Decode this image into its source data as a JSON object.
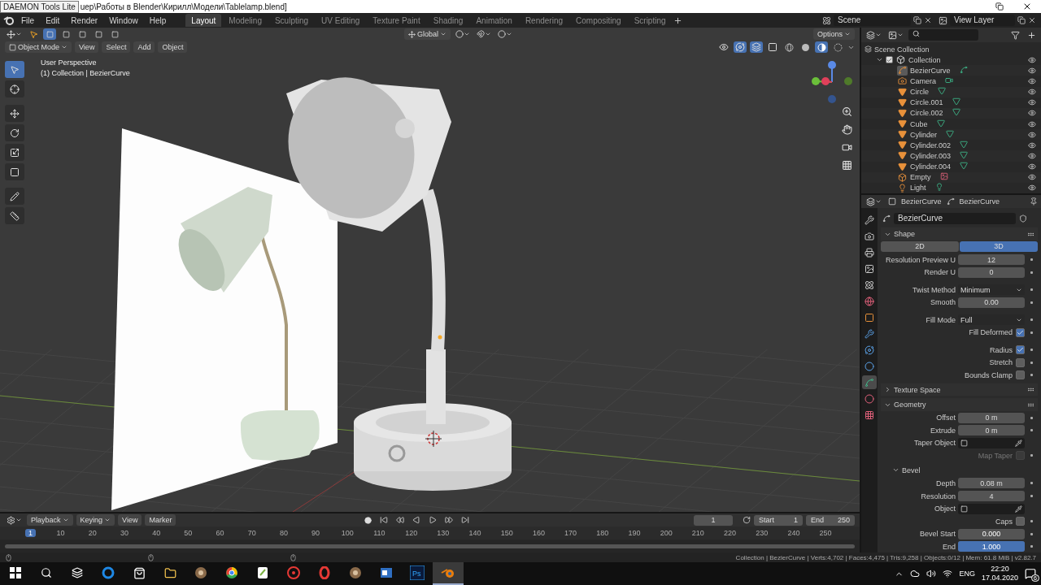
{
  "title_bar": {
    "tooltip": "DAEMON Tools Lite",
    "path": "uep\\Работы в Blender\\Кирилл\\Модели\\Tablelamp.blend]"
  },
  "menu": [
    "File",
    "Edit",
    "Render",
    "Window",
    "Help"
  ],
  "workspaces": [
    {
      "label": "Layout",
      "selected": true
    },
    {
      "label": "Modeling",
      "selected": false
    },
    {
      "label": "Sculpting",
      "selected": false
    },
    {
      "label": "UV Editing",
      "selected": false
    },
    {
      "label": "Texture Paint",
      "selected": false
    },
    {
      "label": "Shading",
      "selected": false
    },
    {
      "label": "Animation",
      "selected": false
    },
    {
      "label": "Rendering",
      "selected": false
    },
    {
      "label": "Compositing",
      "selected": false
    },
    {
      "label": "Scripting",
      "selected": false
    }
  ],
  "scene": "Scene",
  "view_layer": "View Layer",
  "viewport": {
    "select_modes": [
      {
        "selected": true
      },
      {
        "selected": false
      },
      {
        "selected": false
      },
      {
        "selected": false
      },
      {
        "selected": false
      }
    ],
    "orientation": "Global",
    "options": "Options",
    "mode": "Object Mode",
    "menus": [
      "View",
      "Select",
      "Add",
      "Object"
    ],
    "toggles": [
      {
        "kind": "visibility",
        "on": false
      },
      {
        "kind": "gizmo",
        "on": true
      },
      {
        "kind": "overlay",
        "on": true
      },
      {
        "kind": "xray",
        "on": false
      }
    ],
    "shading": [
      {
        "kind": "wireframe",
        "selected": false
      },
      {
        "kind": "solid",
        "selected": false
      },
      {
        "kind": "material",
        "selected": true
      },
      {
        "kind": "rendered",
        "selected": false
      }
    ],
    "overlay_title": "User Perspective",
    "overlay_subtitle": "(1) Collection | BezierCurve",
    "tools": [
      {
        "kind": "select",
        "selected": true
      },
      {
        "kind": "cursor",
        "selected": false
      },
      {
        "kind": "move",
        "selected": false
      },
      {
        "kind": "rotate",
        "selected": false
      },
      {
        "kind": "scale",
        "selected": false
      },
      {
        "kind": "transform",
        "selected": false
      },
      {
        "kind": "annotate",
        "selected": false
      },
      {
        "kind": "measure",
        "selected": false
      }
    ]
  },
  "outliner": {
    "root": "Scene Collection",
    "tree": [
      {
        "name": "Collection",
        "kind": "collection",
        "checked": true,
        "expanded": true,
        "children": [
          {
            "name": "BezierCurve",
            "kind": "curve",
            "selected": true
          },
          {
            "name": "Camera",
            "kind": "camera",
            "selected": false
          },
          {
            "name": "Circle",
            "kind": "mesh",
            "selected": false
          },
          {
            "name": "Circle.001",
            "kind": "mesh",
            "selected": false
          },
          {
            "name": "Circle.002",
            "kind": "mesh",
            "selected": false
          },
          {
            "name": "Cube",
            "kind": "mesh",
            "selected": false
          },
          {
            "name": "Cylinder",
            "kind": "mesh",
            "selected": false
          },
          {
            "name": "Cylinder.002",
            "kind": "mesh",
            "selected": false
          },
          {
            "name": "Cylinder.003",
            "kind": "mesh",
            "selected": false
          },
          {
            "name": "Cylinder.004",
            "kind": "mesh",
            "selected": false
          },
          {
            "name": "Empty",
            "kind": "empty",
            "selected": false
          },
          {
            "name": "Light",
            "kind": "light",
            "selected": false
          }
        ]
      }
    ]
  },
  "properties": {
    "object": "BezierCurve",
    "data": "BezierCurve",
    "datablock": "BezierCurve",
    "tabs": [
      {
        "kind": "tool",
        "selected": false
      },
      {
        "kind": "render",
        "selected": false
      },
      {
        "kind": "output",
        "selected": false
      },
      {
        "kind": "view-layer",
        "selected": false
      },
      {
        "kind": "scene",
        "selected": false
      },
      {
        "kind": "world",
        "selected": false
      },
      {
        "kind": "object",
        "selected": false
      },
      {
        "kind": "modifier",
        "selected": false
      },
      {
        "kind": "particles",
        "selected": false
      },
      {
        "kind": "physics",
        "selected": false
      },
      {
        "kind": "data",
        "selected": true
      },
      {
        "kind": "material",
        "selected": false
      },
      {
        "kind": "texture",
        "selected": false
      }
    ],
    "sections": [
      {
        "title": "Shape",
        "expanded": true,
        "rows": [
          {
            "kind": "toggle",
            "options": [
              {
                "label": "2D",
                "selected": false
              },
              {
                "label": "3D",
                "selected": true
              }
            ]
          },
          {
            "kind": "number",
            "label": "Resolution Preview U",
            "value": "12"
          },
          {
            "kind": "number",
            "label": "Render U",
            "value": "0"
          },
          {
            "kind": "gap"
          },
          {
            "kind": "dropdown",
            "label": "Twist Method",
            "value": "Minimum"
          },
          {
            "kind": "number",
            "label": "Smooth",
            "value": "0.00"
          },
          {
            "kind": "gap"
          },
          {
            "kind": "dropdown",
            "label": "Fill Mode",
            "value": "Full"
          },
          {
            "kind": "checkbox",
            "label": "Fill Deformed",
            "checked": true,
            "disabled": false
          },
          {
            "kind": "gap"
          },
          {
            "kind": "checkbox",
            "label": "Radius",
            "checked": true,
            "disabled": false
          },
          {
            "kind": "checkbox",
            "label": "Stretch",
            "checked": false,
            "disabled": false
          },
          {
            "kind": "checkbox",
            "label": "Bounds Clamp",
            "checked": false,
            "disabled": false
          }
        ]
      },
      {
        "title": "Texture Space",
        "expanded": false
      },
      {
        "title": "Geometry",
        "expanded": true,
        "rows": [
          {
            "kind": "number",
            "label": "Offset",
            "value": "0 m"
          },
          {
            "kind": "number",
            "label": "Extrude",
            "value": "0 m"
          },
          {
            "kind": "object",
            "label": "Taper Object"
          },
          {
            "kind": "checkbox",
            "label": "Map Taper",
            "checked": false,
            "disabled": true
          },
          {
            "kind": "subsection",
            "title": "Bevel",
            "expanded": true
          },
          {
            "kind": "number",
            "label": "Depth",
            "value": "0.08 m"
          },
          {
            "kind": "number",
            "label": "Resolution",
            "value": "4"
          },
          {
            "kind": "object",
            "label": "Object"
          },
          {
            "kind": "checkbox",
            "label": "Caps",
            "checked": false,
            "disabled": false
          },
          {
            "kind": "slider",
            "label": "Bevel Start",
            "value": "0.000",
            "level": 0
          },
          {
            "kind": "slider",
            "label": "End",
            "value": "1.000",
            "level": 1
          }
        ]
      }
    ]
  },
  "timeline": {
    "menus": [
      {
        "label": "Playback",
        "dropdown": true
      },
      {
        "label": "Keying",
        "dropdown": true
      },
      {
        "label": "View",
        "dropdown": false
      },
      {
        "label": "Marker",
        "dropdown": false
      }
    ],
    "current": "1",
    "start_label": "Start",
    "start": "1",
    "end_label": "End",
    "end": "250",
    "ticks": [
      {
        "label": "1",
        "selected": true
      },
      {
        "label": "10",
        "selected": false
      },
      {
        "label": "20",
        "selected": false
      },
      {
        "label": "30",
        "selected": false
      },
      {
        "label": "40",
        "selected": false
      },
      {
        "label": "50",
        "selected": false
      },
      {
        "label": "60",
        "selected": false
      },
      {
        "label": "70",
        "selected": false
      },
      {
        "label": "80",
        "selected": false
      },
      {
        "label": "90",
        "selected": false
      },
      {
        "label": "100",
        "selected": false
      },
      {
        "label": "110",
        "selected": false
      },
      {
        "label": "120",
        "selected": false
      },
      {
        "label": "130",
        "selected": false
      },
      {
        "label": "140",
        "selected": false
      },
      {
        "label": "150",
        "selected": false
      },
      {
        "label": "160",
        "selected": false
      },
      {
        "label": "170",
        "selected": false
      },
      {
        "label": "180",
        "selected": false
      },
      {
        "label": "190",
        "selected": false
      },
      {
        "label": "200",
        "selected": false
      },
      {
        "label": "210",
        "selected": false
      },
      {
        "label": "220",
        "selected": false
      },
      {
        "label": "230",
        "selected": false
      },
      {
        "label": "240",
        "selected": false
      },
      {
        "label": "250",
        "selected": false
      }
    ]
  },
  "status_bar": "Collection | BezierCurve | Verts:4,702 | Faces:4,475 | Tris:9,258 | Objects:0/12 | Mem: 61.8 MiB | v2.82.7",
  "taskbar": {
    "apps": [
      {
        "kind": "start",
        "active": false
      },
      {
        "kind": "search",
        "active": false
      },
      {
        "kind": "task-view",
        "active": false
      },
      {
        "kind": "edge",
        "active": false
      },
      {
        "kind": "store",
        "active": false
      },
      {
        "kind": "folder",
        "active": false
      },
      {
        "kind": "round",
        "active": false
      },
      {
        "kind": "chrome",
        "active": false
      },
      {
        "kind": "note",
        "active": false
      },
      {
        "kind": "disc",
        "active": false
      },
      {
        "kind": "opera",
        "active": false
      },
      {
        "kind": "round",
        "active": false
      },
      {
        "kind": "window",
        "active": false
      },
      {
        "kind": "ps",
        "label": "Ps",
        "active": false
      },
      {
        "kind": "blender",
        "active": true
      }
    ],
    "language": "ENG",
    "time": "22:20",
    "date": "17.04.2020",
    "notifications": "6"
  }
}
